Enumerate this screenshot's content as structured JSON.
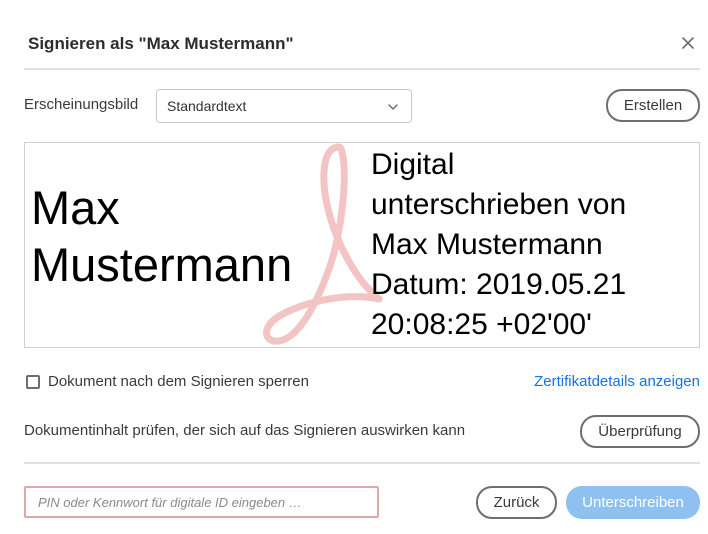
{
  "dialog": {
    "title": "Signieren als \"Max Mustermann\"",
    "close_icon": "close-icon"
  },
  "appearance": {
    "label": "Erscheinungsbild",
    "selected": "Standardtext",
    "create_label": "Erstellen"
  },
  "preview": {
    "name_line1": "Max",
    "name_line2": "Mustermann",
    "details": [
      "Digital",
      "unterschrieben von",
      "Max Mustermann",
      "Datum: 2019.05.21",
      "20:08:25 +02'00'"
    ],
    "logo_icon": "acrobat-logo-icon"
  },
  "options": {
    "lock_label": "Dokument nach dem Signieren sperren",
    "lock_checked": false,
    "cert_link": "Zertifikatdetails anzeigen",
    "review_text": "Dokumentinhalt prüfen, der sich auf das Signieren auswirken kann",
    "review_label": "Überprüfung"
  },
  "footer": {
    "pin_placeholder": "PIN oder Kennwort für digitale ID eingeben …",
    "pin_value": "",
    "back_label": "Zurück",
    "sign_label": "Unterschreiben"
  },
  "colors": {
    "link": "#1473e6",
    "primary_disabled": "#8fc1f0",
    "input_error_border": "#e0a7a7",
    "logo_watermark": "#f2c4c4"
  }
}
